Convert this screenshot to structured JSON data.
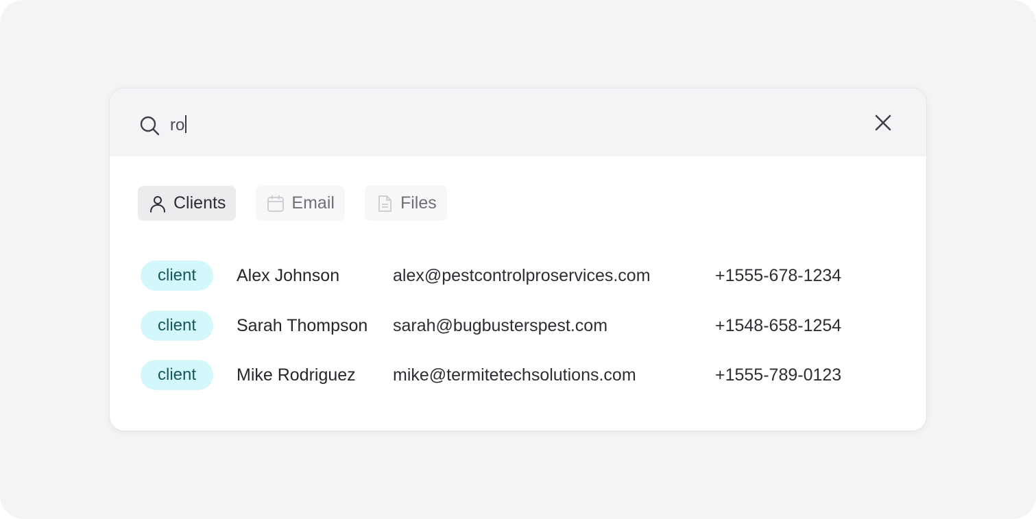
{
  "search": {
    "value": "ro",
    "icon": "search-icon",
    "close_icon": "close-icon"
  },
  "tabs": [
    {
      "label": "Clients",
      "icon": "user-icon",
      "active": true
    },
    {
      "label": "Email",
      "icon": "calendar-icon",
      "active": false
    },
    {
      "label": "Files",
      "icon": "file-icon",
      "active": false
    }
  ],
  "results": [
    {
      "badge": "client",
      "name": "Alex Johnson",
      "email": "alex@pestcontrolproservices.com",
      "phone": "+1555-678-1234"
    },
    {
      "badge": "client",
      "name": "Sarah Thompson",
      "email": "sarah@bugbusterspest.com",
      "phone": "+1548-658-1254"
    },
    {
      "badge": "client",
      "name": "Mike Rodriguez",
      "email": "mike@termitetechsolutions.com",
      "phone": "+1555-789-0123"
    }
  ],
  "colors": {
    "badge_bg": "#d3f8fb",
    "badge_text": "#17555f",
    "active_tab_bg": "#ececee"
  }
}
